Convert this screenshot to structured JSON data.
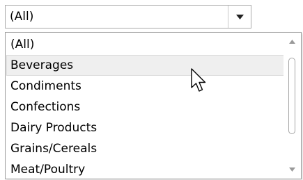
{
  "combo": {
    "selected": "(All)",
    "arrow_icon": "triangle-down-icon"
  },
  "dropdown": {
    "items": [
      "(All)",
      "Beverages",
      "Condiments",
      "Confections",
      "Dairy Products",
      "Grains/Cereals",
      "Meat/Poultry"
    ],
    "hovered_item": "Beverages"
  },
  "scrollbar": {
    "up_icon": "triangle-up-icon",
    "down_icon": "triangle-down-icon"
  },
  "cursor": {
    "icon": "mouse-pointer-icon"
  }
}
